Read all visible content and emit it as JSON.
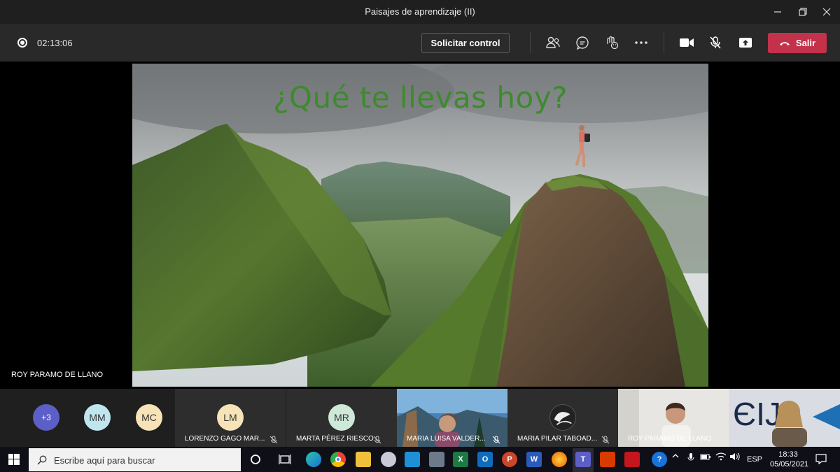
{
  "window": {
    "title": "Paisajes de aprendizaje (II)"
  },
  "toolbar": {
    "timer": "02:13:06",
    "request_control_label": "Solicitar control",
    "leave_label": "Salir",
    "leave_color": "#c4314b"
  },
  "slide": {
    "title": "¿Qué te llevas hoy?",
    "title_color": "#3e8a2e"
  },
  "stage": {
    "presenter_label": "ROY PARAMO DE LLANO"
  },
  "participants": {
    "overflow_count": "+3",
    "avatars": [
      {
        "initials": "MM",
        "color": "#bfe6ee"
      },
      {
        "initials": "MC",
        "color": "#f7e3b8"
      }
    ],
    "tiles": [
      {
        "initials": "LM",
        "name": "LORENZO GAGO MAR...",
        "avatar_color": "#f7e3b8"
      },
      {
        "initials": "MR",
        "name": "MARTA PÉREZ RIESCO",
        "avatar_color": "#cfe9d9"
      },
      {
        "name": "MARIA LUISA VALDER..."
      },
      {
        "name": "MARIA PILAR TABOAD..."
      },
      {
        "name": "ROY PARAMO DE LLANO"
      }
    ]
  },
  "taskbar": {
    "search_placeholder": "Escribe aquí para buscar",
    "language": "ESP",
    "time": "18:33",
    "date": "05/05/2021"
  }
}
